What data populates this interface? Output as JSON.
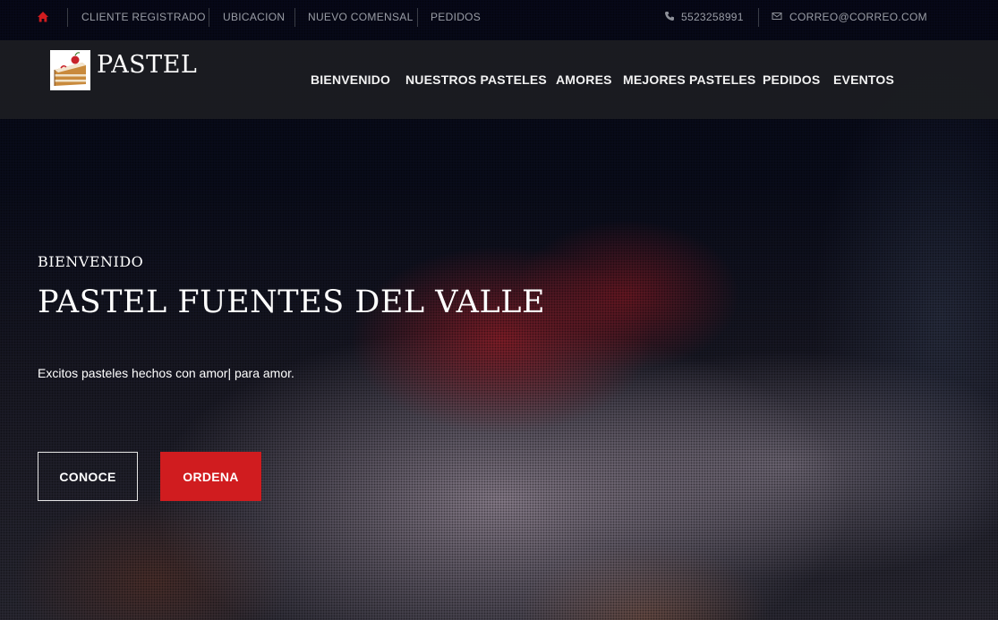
{
  "colors": {
    "accent": "#d01c1f",
    "home_icon": "#d01c1f"
  },
  "topbar": {
    "home_icon": "home-icon",
    "links": [
      "CLIENTE REGISTRADO",
      "UBICACION",
      "NUEVO COMENSAL",
      "PEDIDOS"
    ],
    "phone_icon": "phone-icon",
    "phone": "5523258991",
    "mail_icon": "envelope-icon",
    "email": "CORREO@CORREO.COM"
  },
  "navbar": {
    "logo_icon": "cake-slice-icon",
    "brand": "PASTEL",
    "menu": [
      "BIENVENIDO",
      "NUESTROS PASTELES",
      "AMORES",
      "MEJORES PASTELES",
      "PEDIDOS",
      "EVENTOS"
    ]
  },
  "hero": {
    "eyebrow": "BIENVENIDO",
    "title": "PASTEL FUENTES DEL VALLE",
    "subtitle": "Excitos pasteles hechos con amor| para amor.",
    "primary_button": "CONOCE",
    "secondary_button": "ORDENA"
  }
}
